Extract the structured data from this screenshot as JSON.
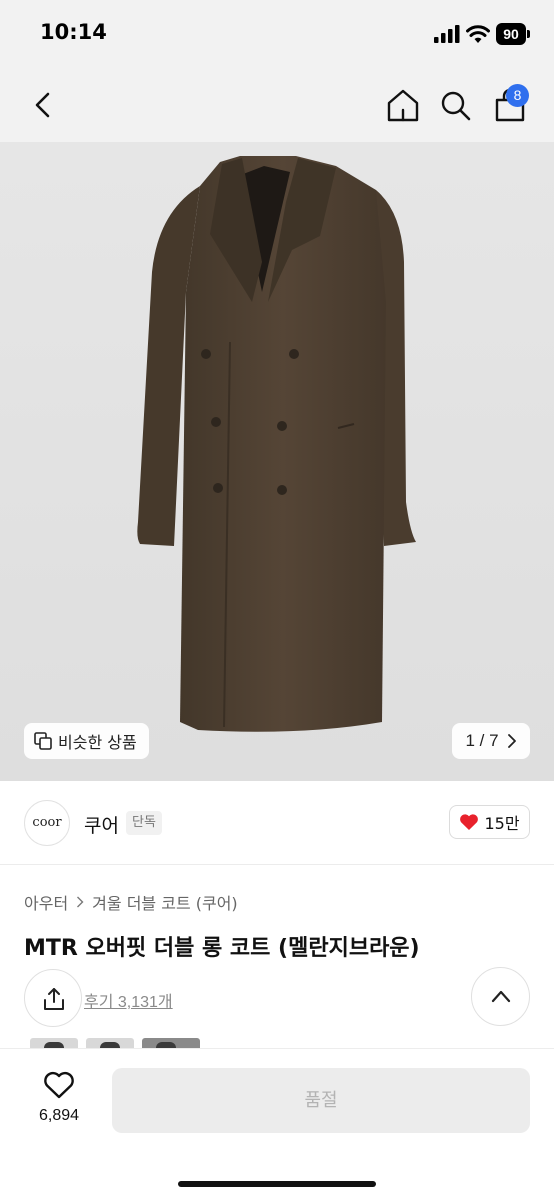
{
  "status_bar": {
    "time": "10:14",
    "battery": "90"
  },
  "nav": {
    "cart_count": "8"
  },
  "hero": {
    "similar_label": "비슷한 상품",
    "pager": "1 / 7"
  },
  "brand": {
    "logo_text": "coor",
    "name": "쿠어",
    "tag": "단독",
    "likes": "15만"
  },
  "product": {
    "breadcrumb": [
      "아우터",
      "겨울 더블 코트 (쿠어)"
    ],
    "title": "MTR 오버핏 더블 롱 코트 (멜란지브라운)",
    "reviews": "후기 3,131개"
  },
  "bottom": {
    "wish_count": "6,894",
    "soldout_label": "품절"
  },
  "colors": {
    "accent_blue": "#2f6fee",
    "heart_red": "#e8212c",
    "coat_brown": "#4e3f31"
  }
}
